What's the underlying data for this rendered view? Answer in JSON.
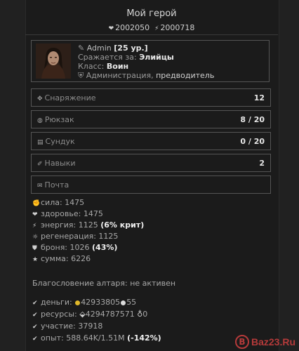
{
  "header": {
    "title": "Мой герой",
    "stat1": "2002050",
    "stat2": "2000718"
  },
  "profile": {
    "name": "Admin",
    "level": "[25 ур.]",
    "fights_label": "Сражается за:",
    "fights_value": "Элийцы",
    "class_label": "Класс:",
    "class_value": "Воин",
    "role_label": "Администрация,",
    "role_value": "предводитель"
  },
  "sections": [
    {
      "label": "Снаряжение",
      "value": "12",
      "icon": "gear-icon"
    },
    {
      "label": "Рюкзак",
      "value": "8 / 20",
      "icon": "backpack-icon"
    },
    {
      "label": "Сундук",
      "value": "0 / 20",
      "icon": "chest-icon"
    },
    {
      "label": "Навыки",
      "value": "2",
      "icon": "skills-icon"
    },
    {
      "label": "Почта",
      "value": "",
      "icon": "mail-icon"
    }
  ],
  "attributes": {
    "strength": "сила: 1475",
    "health": "здоровье: 1475",
    "energy": "энергия: 1125",
    "energy_crit": "(6% крит)",
    "regen": "регенерация: 1125",
    "armor": "броня: 1026",
    "armor_pct": "(43%)",
    "total": "сумма: 6226"
  },
  "blessing": "Благословение алтаря: не активен",
  "resources": {
    "money_label": "деньги:",
    "gold": "42933805",
    "silver": "55",
    "res_label": "ресурсы:",
    "res_value": "4294787571",
    "res_value2": "0",
    "participation": "участие: 37918",
    "experience": "опыт: 588.64K/1.51M",
    "experience_pct": "(-142%)"
  },
  "watermark": {
    "text": "Baz23.Ru"
  },
  "colors": {
    "gold": "#e0b82a",
    "silver": "#dcdcdc",
    "watermark": "#b53a3a"
  }
}
